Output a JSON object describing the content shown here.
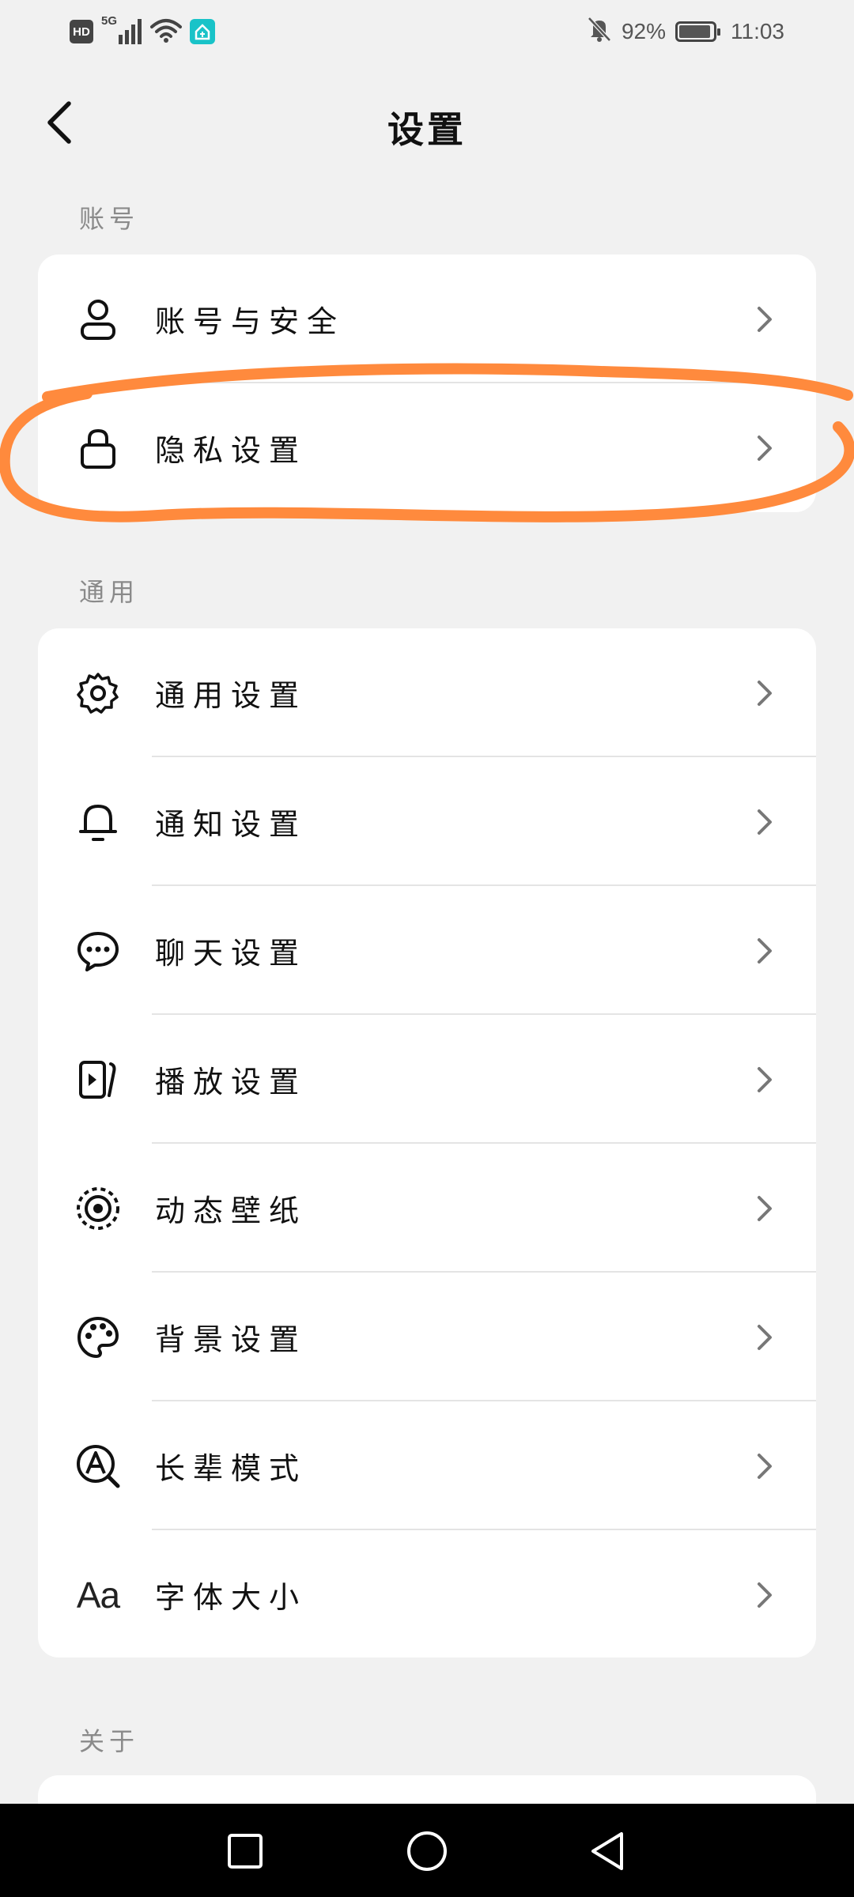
{
  "status_bar": {
    "hd": "HD",
    "network": "5G",
    "battery_percent_text": "92%",
    "battery_level": 0.92,
    "time": "11:03"
  },
  "header": {
    "title": "设置"
  },
  "sections": [
    {
      "label": "账号",
      "items": [
        {
          "label": "账号与安全",
          "icon": "person-icon"
        },
        {
          "label": "隐私设置",
          "icon": "lock-icon"
        }
      ]
    },
    {
      "label": "通用",
      "items": [
        {
          "label": "通用设置",
          "icon": "gear-icon"
        },
        {
          "label": "通知设置",
          "icon": "bell-icon"
        },
        {
          "label": "聊天设置",
          "icon": "chat-bubble-icon"
        },
        {
          "label": "播放设置",
          "icon": "play-icon"
        },
        {
          "label": "动态壁纸",
          "icon": "live-wallpaper-icon"
        },
        {
          "label": "背景设置",
          "icon": "palette-icon"
        },
        {
          "label": "长辈模式",
          "icon": "elder-mode-icon"
        },
        {
          "label": "字体大小",
          "icon": "font-size-icon",
          "icon_text": "Aa"
        }
      ]
    },
    {
      "label": "关于",
      "items": []
    }
  ],
  "colors": {
    "background": "#f1f1f1",
    "card": "#ffffff",
    "highlight": "#ff8a3d",
    "section_label": "#8a8a8a"
  }
}
